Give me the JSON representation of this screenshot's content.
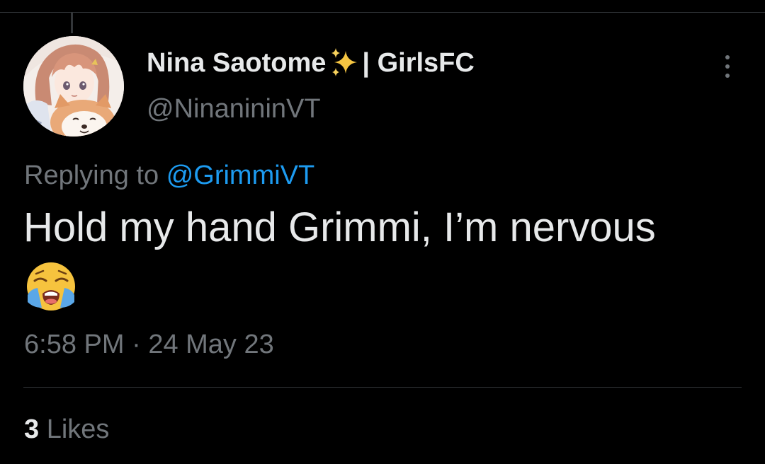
{
  "tweet": {
    "author": {
      "display_name": "Nina Saotome",
      "display_name_suffix": "| GirlsFC",
      "name_emoji_icon": "sparkles-icon",
      "handle": "@NinanininVT",
      "avatar_icon": "anime-girl-with-dog-avatar"
    },
    "reply_prefix": "Replying to",
    "reply_to": "@GrimmiVT",
    "text": "Hold my hand Grimmi, I’m nervous",
    "text_emoji_icon": "loudly-crying-face-icon",
    "time": "6:58 PM",
    "separator": "·",
    "date": "24 May 23",
    "likes_count": "3",
    "likes_label": "Likes",
    "more_icon": "more-vertical-icon"
  },
  "colors": {
    "background": "#000000",
    "text_primary": "#e7e9ea",
    "text_secondary": "#71767b",
    "link": "#1d9bf0",
    "divider": "#2f3336"
  }
}
